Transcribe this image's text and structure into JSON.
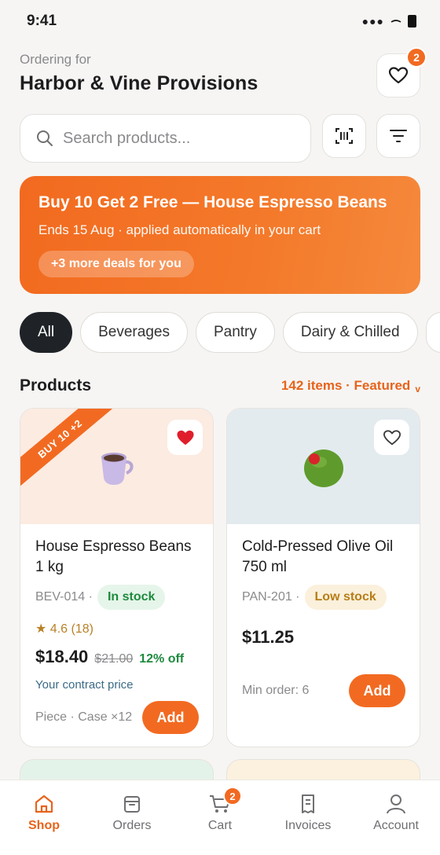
{
  "status": {
    "time": "9:41"
  },
  "header": {
    "subtitle": "Ordering for",
    "title": "Harbor & Vine Provisions",
    "favorites_count": "2"
  },
  "search": {
    "placeholder": "Search products..."
  },
  "promo": {
    "title": "Buy 10 Get 2 Free — House Espresso Beans",
    "subtitle": "Ends 15 Aug · applied automatically in your cart",
    "pill": "+3 more deals for you"
  },
  "categories": [
    "All",
    "Beverages",
    "Pantry",
    "Dairy & Chilled"
  ],
  "products_section": {
    "title": "Products",
    "sort": "142 items · Featured",
    "sort_chevron": "v"
  },
  "products": [
    {
      "ribbon": "BUY 10 +2",
      "name_line1": "House Espresso Beans",
      "name_line2": "1 kg",
      "sku": "BEV-014 ·",
      "stock": "In stock",
      "rating": "★ 4.6 (18)",
      "price": "$18.40",
      "old_price": "$21.00",
      "discount": "12% off",
      "contract": "Your contract price",
      "unit": "Piece · Case ×12",
      "add": "Add",
      "favorited": true,
      "image_bg": "#fcebe1"
    },
    {
      "name_line1": "Cold-Pressed Olive Oil",
      "name_line2": "750 ml",
      "sku": "PAN-201 ·",
      "stock": "Low stock",
      "price": "$11.25",
      "unit": "Min order: 6",
      "add": "Add",
      "favorited": false,
      "image_bg": "#e3ebef"
    }
  ],
  "tabs": [
    {
      "label": "Shop",
      "icon": "home-icon",
      "active": true
    },
    {
      "label": "Orders",
      "icon": "box-icon",
      "active": false
    },
    {
      "label": "Cart",
      "icon": "cart-icon",
      "active": false,
      "badge": "2"
    },
    {
      "label": "Invoices",
      "icon": "receipt-icon",
      "active": false
    },
    {
      "label": "Account",
      "icon": "person-icon",
      "active": false
    }
  ],
  "colors": {
    "accent": "#f26a21",
    "dark_chip": "#1f2328",
    "in_stock": "#1d8a3e",
    "low_stock": "#b77d16"
  }
}
